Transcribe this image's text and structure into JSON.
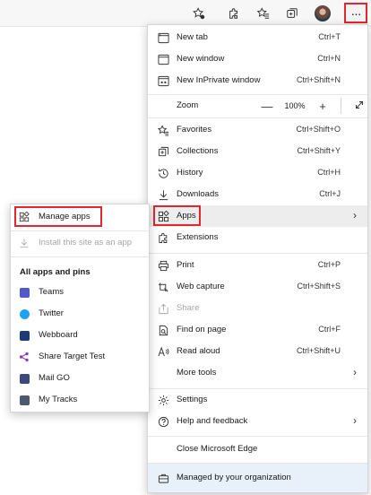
{
  "toolbar": {
    "icons": [
      "favorite-add-icon",
      "extensions-icon",
      "favorites-icon",
      "collections-icon",
      "profile-avatar",
      "settings-and-more-icon"
    ],
    "more_label": "···"
  },
  "menu": {
    "new_tab": {
      "label": "New tab",
      "shortcut": "Ctrl+T"
    },
    "new_window": {
      "label": "New window",
      "shortcut": "Ctrl+N"
    },
    "new_inprivate": {
      "label": "New InPrivate window",
      "shortcut": "Ctrl+Shift+N"
    },
    "zoom": {
      "label": "Zoom",
      "minus": "—",
      "value": "100%",
      "plus": "+"
    },
    "favorites": {
      "label": "Favorites",
      "shortcut": "Ctrl+Shift+O"
    },
    "collections": {
      "label": "Collections",
      "shortcut": "Ctrl+Shift+Y"
    },
    "history": {
      "label": "History",
      "shortcut": "Ctrl+H"
    },
    "downloads": {
      "label": "Downloads",
      "shortcut": "Ctrl+J"
    },
    "apps": {
      "label": "Apps",
      "chevron": "›"
    },
    "extensions": {
      "label": "Extensions"
    },
    "print": {
      "label": "Print",
      "shortcut": "Ctrl+P"
    },
    "web_capture": {
      "label": "Web capture",
      "shortcut": "Ctrl+Shift+S"
    },
    "share": {
      "label": "Share"
    },
    "find_on_page": {
      "label": "Find on page",
      "shortcut": "Ctrl+F"
    },
    "read_aloud": {
      "label": "Read aloud",
      "shortcut": "Ctrl+Shift+U"
    },
    "more_tools": {
      "label": "More tools",
      "chevron": "›"
    },
    "settings": {
      "label": "Settings"
    },
    "help": {
      "label": "Help and feedback",
      "chevron": "›"
    },
    "close": {
      "label": "Close Microsoft Edge"
    },
    "managed": {
      "label": "Managed by your organization"
    }
  },
  "submenu": {
    "manage_apps": "Manage apps",
    "install_site": "Install this site as an app",
    "heading": "All apps and pins",
    "apps": [
      {
        "label": "Teams",
        "color": "#5059c9"
      },
      {
        "label": "Twitter",
        "color": "#1da1f2"
      },
      {
        "label": "Webboard",
        "color": "#1f3a7a"
      },
      {
        "label": "Share Target Test",
        "color": "#8a3fb7"
      },
      {
        "label": "Mail GO",
        "color": "#3b4a7a"
      },
      {
        "label": "My Tracks",
        "color": "#4b5a6e"
      }
    ]
  },
  "colors": {
    "highlight": "#e3262f",
    "accent": "#0067c0"
  }
}
